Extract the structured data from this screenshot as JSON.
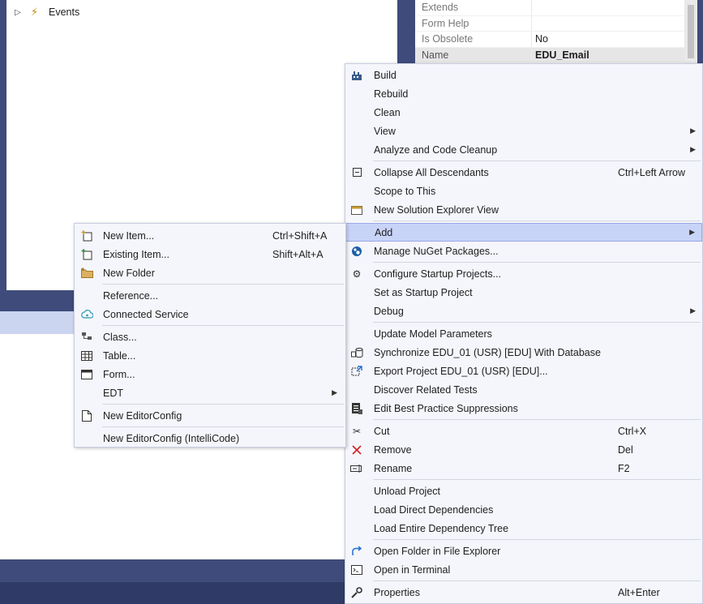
{
  "tree": {
    "events_label": "Events"
  },
  "properties": [
    {
      "key": "Extends",
      "value": ""
    },
    {
      "key": "Form Help",
      "value": ""
    },
    {
      "key": "Is Obsolete",
      "value": "No"
    },
    {
      "key": "Name",
      "value": "EDU_Email"
    }
  ],
  "main_menu": {
    "build": "Build",
    "rebuild": "Rebuild",
    "clean": "Clean",
    "view": "View",
    "analyze": "Analyze and Code Cleanup",
    "collapse": "Collapse All Descendants",
    "collapse_shortcut": "Ctrl+Left Arrow",
    "scope": "Scope to This",
    "new_view": "New Solution Explorer View",
    "add": "Add",
    "nuget": "Manage NuGet Packages...",
    "configure_startup": "Configure Startup Projects...",
    "set_startup": "Set as Startup Project",
    "debug": "Debug",
    "update_model": "Update Model Parameters",
    "synchronize": "Synchronize EDU_01 (USR) [EDU] With Database",
    "export": "Export Project EDU_01 (USR) [EDU]...",
    "discover_tests": "Discover Related Tests",
    "edit_bp": "Edit Best Practice Suppressions",
    "cut": "Cut",
    "cut_shortcut": "Ctrl+X",
    "remove": "Remove",
    "remove_shortcut": "Del",
    "rename": "Rename",
    "rename_shortcut": "F2",
    "unload": "Unload Project",
    "load_direct": "Load Direct Dependencies",
    "load_tree": "Load Entire Dependency Tree",
    "open_folder": "Open Folder in File Explorer",
    "open_terminal": "Open in Terminal",
    "properties": "Properties",
    "properties_shortcut": "Alt+Enter"
  },
  "add_menu": {
    "new_item": "New Item...",
    "new_item_shortcut": "Ctrl+Shift+A",
    "existing_item": "Existing Item...",
    "existing_item_shortcut": "Shift+Alt+A",
    "new_folder": "New Folder",
    "reference": "Reference...",
    "connected_service": "Connected Service",
    "class": "Class...",
    "table": "Table...",
    "form": "Form...",
    "edt": "EDT",
    "new_editorconfig": "New EditorConfig",
    "new_editorconfig_intellicode": "New EditorConfig (IntelliCode)"
  }
}
